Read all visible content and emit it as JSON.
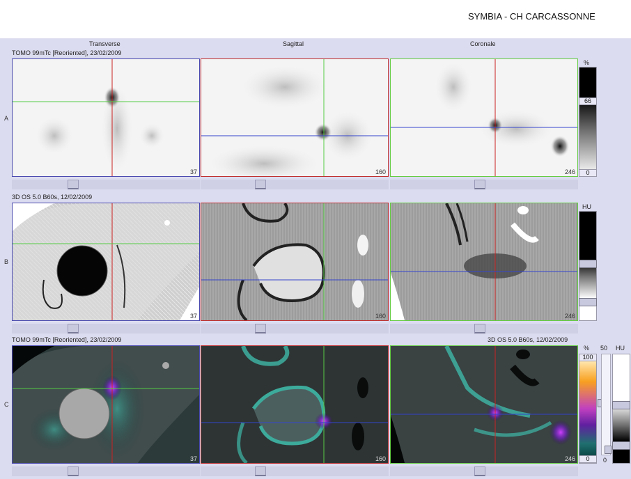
{
  "header": {
    "title": "SYMBIA - CH CARCASSONNE"
  },
  "columns": [
    "Transverse",
    "Sagittal",
    "Coronale"
  ],
  "rows": [
    {
      "letter": "A",
      "info_left": "TOMO 99mTc [Reoriented], 23/02/2009",
      "info_right": "",
      "slices": [
        "37",
        "160",
        "246"
      ],
      "scale_unit": "%",
      "scale_top": "66",
      "scale_bottom": "0"
    },
    {
      "letter": "B",
      "info_left": "3D  OS  5.0  B60s, 12/02/2009",
      "info_right": "",
      "slices": [
        "37",
        "160",
        "246"
      ],
      "scale_unit": "HU"
    },
    {
      "letter": "C",
      "info_left": "TOMO 99mTc [Reoriented], 23/02/2009",
      "info_right": "3D  OS  5.0  B60s, 12/02/2009",
      "slices": [
        "37",
        "160",
        "246"
      ],
      "scale_unit": "%",
      "scale_top": "100",
      "scale_bottom": "0",
      "slider_value": "50",
      "slider_min": "0",
      "scale_unit2": "HU"
    }
  ]
}
